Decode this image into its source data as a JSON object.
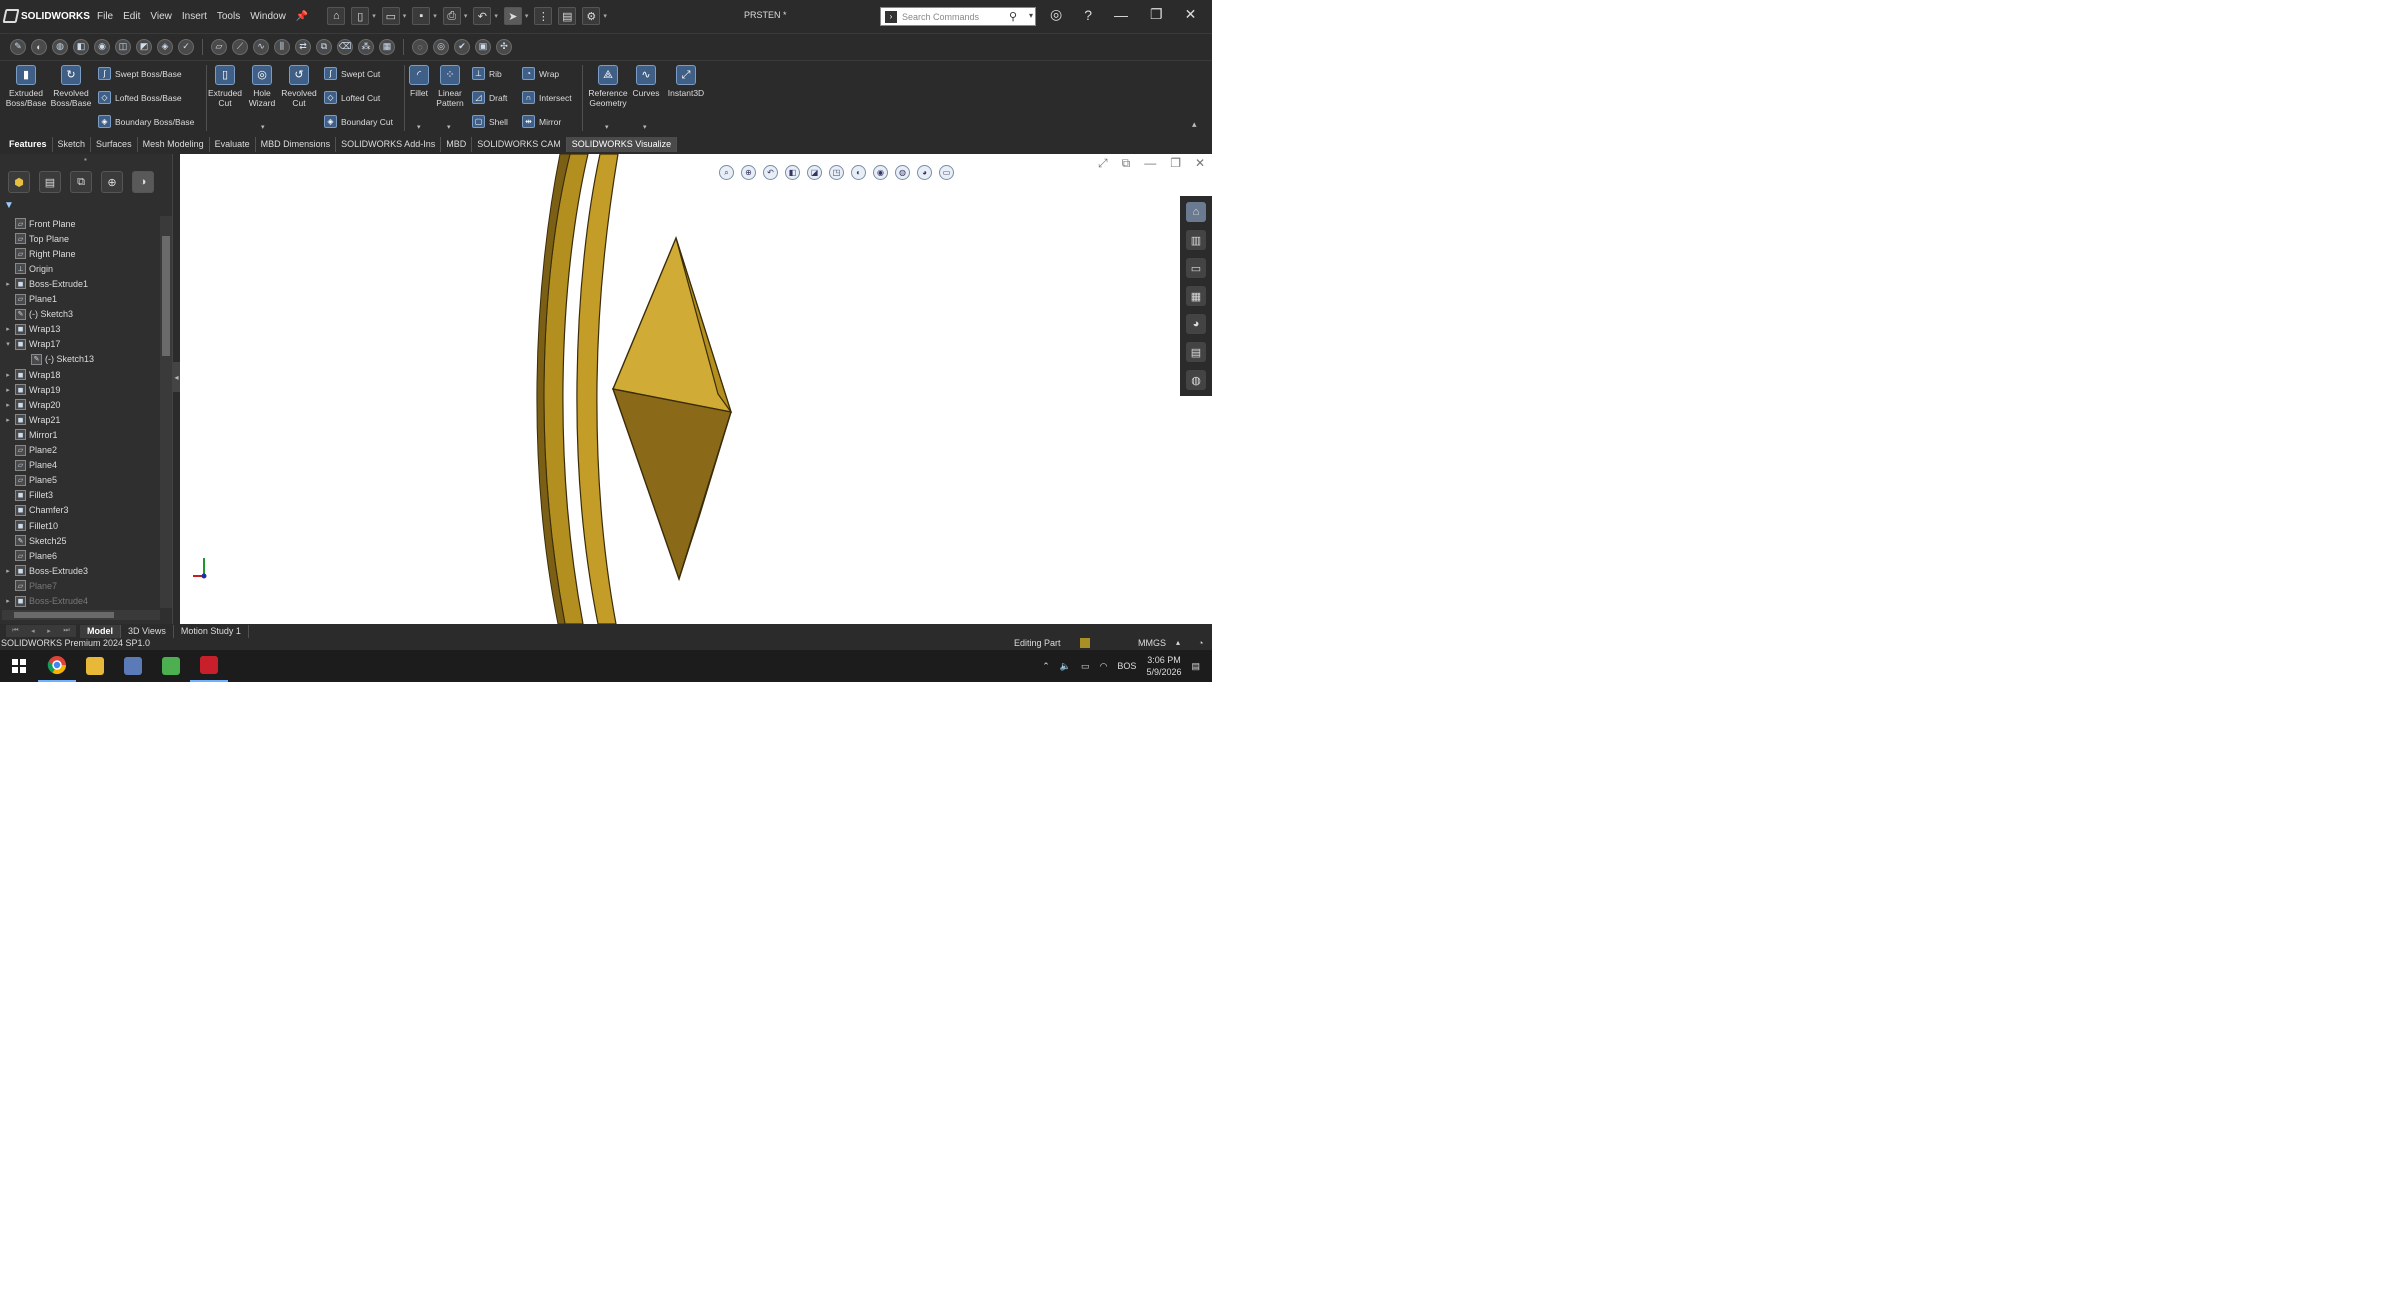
{
  "app": {
    "name": "SOLIDWORKS",
    "document_title": "PRSTEN *",
    "menu": [
      "File",
      "Edit",
      "View",
      "Insert",
      "Tools",
      "Window"
    ],
    "search_placeholder": "Search Commands"
  },
  "command_manager": {
    "large": [
      {
        "id": "extruded_boss",
        "label": "Extruded Boss/Base"
      },
      {
        "id": "revolved_boss",
        "label": "Revolved Boss/Base"
      },
      {
        "id": "extruded_cut",
        "label": "Extruded Cut"
      },
      {
        "id": "hole_wizard",
        "label": "Hole Wizard"
      },
      {
        "id": "revolved_cut",
        "label": "Revolved Cut"
      },
      {
        "id": "fillet",
        "label": "Fillet"
      },
      {
        "id": "linear_pattern",
        "label": "Linear Pattern"
      },
      {
        "id": "reference_geometry",
        "label": "Reference Geometry"
      },
      {
        "id": "curves",
        "label": "Curves"
      },
      {
        "id": "instant3d",
        "label": "Instant3D"
      }
    ],
    "small": {
      "swept_boss": "Swept Boss/Base",
      "lofted_boss": "Lofted Boss/Base",
      "boundary_boss": "Boundary Boss/Base",
      "swept_cut": "Swept Cut",
      "lofted_cut": "Lofted Cut",
      "boundary_cut": "Boundary Cut",
      "rib": "Rib",
      "draft": "Draft",
      "shell": "Shell",
      "wrap": "Wrap",
      "intersect": "Intersect",
      "mirror": "Mirror"
    }
  },
  "tabs": [
    "Features",
    "Sketch",
    "Surfaces",
    "Mesh Modeling",
    "Evaluate",
    "MBD Dimensions",
    "SOLIDWORKS Add-Ins",
    "MBD",
    "SOLIDWORKS CAM",
    "SOLIDWORKS Visualize"
  ],
  "feature_tree": [
    {
      "label": "Front Plane",
      "type": "plane",
      "expand": ""
    },
    {
      "label": "Top Plane",
      "type": "plane",
      "expand": ""
    },
    {
      "label": "Right Plane",
      "type": "plane",
      "expand": ""
    },
    {
      "label": "Origin",
      "type": "origin",
      "expand": ""
    },
    {
      "label": "Boss-Extrude1",
      "type": "feature",
      "expand": "▸"
    },
    {
      "label": "Plane1",
      "type": "plane",
      "expand": ""
    },
    {
      "label": "(-) Sketch3",
      "type": "sketch",
      "expand": ""
    },
    {
      "label": "Wrap13",
      "type": "feature",
      "expand": "▸"
    },
    {
      "label": "Wrap17",
      "type": "feature",
      "expand": "▾"
    },
    {
      "label": "(-) Sketch13",
      "type": "sketch",
      "expand": "",
      "indent": true
    },
    {
      "label": "Wrap18",
      "type": "feature",
      "expand": "▸"
    },
    {
      "label": "Wrap19",
      "type": "feature",
      "expand": "▸"
    },
    {
      "label": "Wrap20",
      "type": "feature",
      "expand": "▸"
    },
    {
      "label": "Wrap21",
      "type": "feature",
      "expand": "▸"
    },
    {
      "label": "Mirror1",
      "type": "feature",
      "expand": ""
    },
    {
      "label": "Plane2",
      "type": "plane",
      "expand": ""
    },
    {
      "label": "Plane4",
      "type": "plane",
      "expand": ""
    },
    {
      "label": "Plane5",
      "type": "plane",
      "expand": ""
    },
    {
      "label": "Fillet3",
      "type": "feature",
      "expand": ""
    },
    {
      "label": "Chamfer3",
      "type": "feature",
      "expand": ""
    },
    {
      "label": "Fillet10",
      "type": "feature",
      "expand": ""
    },
    {
      "label": "Sketch25",
      "type": "sketch",
      "expand": ""
    },
    {
      "label": "Plane6",
      "type": "plane",
      "expand": ""
    },
    {
      "label": "Boss-Extrude3",
      "type": "feature",
      "expand": "▸"
    },
    {
      "label": "Plane7",
      "type": "plane",
      "expand": "",
      "dim": true
    },
    {
      "label": "Boss-Extrude4",
      "type": "feature",
      "expand": "▸",
      "dim": true
    }
  ],
  "bottom_tabs": [
    "Model",
    "3D Views",
    "Motion Study 1"
  ],
  "status": {
    "product": "SOLIDWORKS Premium 2024 SP1.0",
    "mode": "Editing Part",
    "units": "MMGS"
  },
  "taskbar": {
    "language": "BOS",
    "time": "3:06 PM",
    "date": "5/9/2026"
  },
  "colors": {
    "model_gold": "#b38f20",
    "model_gold_dark": "#6e5512",
    "model_gold_light": "#d0ab35"
  }
}
